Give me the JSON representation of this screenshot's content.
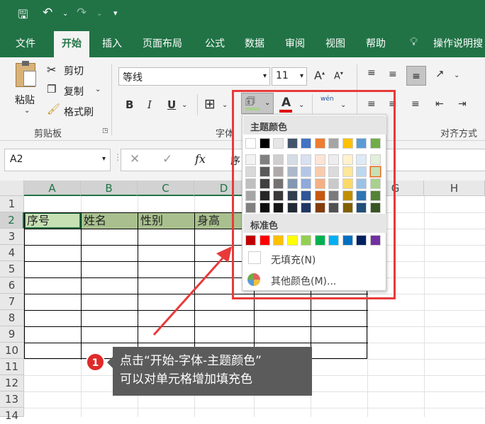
{
  "qat": {
    "save_icon": "save-icon",
    "undo_icon": "undo-icon",
    "redo_icon": "redo-icon",
    "customize_icon": "customize-icon"
  },
  "tabs": [
    "文件",
    "开始",
    "插入",
    "页面布局",
    "公式",
    "数据",
    "审阅",
    "视图",
    "帮助"
  ],
  "search": {
    "label": "操作说明搜",
    "icon": "lightbulb-icon"
  },
  "clipboard": {
    "paste": "粘贴",
    "cut": "剪切",
    "copy": "复制",
    "format_painter": "格式刷",
    "group": "剪贴板"
  },
  "font": {
    "name": "等线",
    "size": "11",
    "bold": "B",
    "italic": "I",
    "underline": "U",
    "font_color": "A",
    "phonetic": "wén",
    "group": "字体"
  },
  "alignment": {
    "group": "对齐方式"
  },
  "formula_bar": {
    "name_box": "A2",
    "value": "序"
  },
  "columns": [
    "A",
    "B",
    "C",
    "D",
    "E",
    "F",
    "G",
    "H"
  ],
  "rows": [
    "1",
    "2",
    "3",
    "4",
    "5",
    "6",
    "7",
    "8",
    "9",
    "10",
    "11",
    "12",
    "13",
    "14"
  ],
  "headers": [
    "序号",
    "姓名",
    "性别",
    "身高"
  ],
  "fill_menu": {
    "theme_title": "主题颜色",
    "standard_title": "标准色",
    "no_fill": "无填充(N)",
    "more_colors": "其他颜色(M)...",
    "theme_row": [
      "#ffffff",
      "#000000",
      "#e7e6e6",
      "#44546a",
      "#4472c4",
      "#ed7d31",
      "#a5a5a5",
      "#ffc000",
      "#5b9bd5",
      "#70ad47"
    ],
    "shades": [
      [
        "#f2f2f2",
        "#7f7f7f",
        "#d0cece",
        "#d6dce4",
        "#d9e1f2",
        "#fce4d6",
        "#ededed",
        "#fff2cc",
        "#ddebf7",
        "#e2efda"
      ],
      [
        "#d9d9d9",
        "#595959",
        "#aeaaaa",
        "#adb9ca",
        "#b4c6e7",
        "#f8cbad",
        "#dbdbdb",
        "#ffe699",
        "#bdd7ee",
        "#c6e0b4"
      ],
      [
        "#bfbfbf",
        "#404040",
        "#757171",
        "#8497b0",
        "#8ea9db",
        "#f4b084",
        "#c9c9c9",
        "#ffd966",
        "#9bc2e6",
        "#a9d08e"
      ],
      [
        "#a6a6a6",
        "#262626",
        "#3a3838",
        "#333f4f",
        "#2f5597",
        "#c65911",
        "#7b7b7b",
        "#bf8f00",
        "#2f75b5",
        "#548235"
      ],
      [
        "#808080",
        "#0d0d0d",
        "#161616",
        "#222b35",
        "#203764",
        "#833c0c",
        "#525252",
        "#806000",
        "#1f4e78",
        "#375623"
      ]
    ],
    "standard": [
      "#c00000",
      "#ff0000",
      "#ffc000",
      "#ffff00",
      "#92d050",
      "#00b050",
      "#00b0f0",
      "#0070c0",
      "#002060",
      "#7030a0"
    ]
  },
  "callout": {
    "number": "1",
    "line1": "点击“开始-字体-主题颜色”",
    "line2": "可以对单元格增加填充色"
  },
  "colors": {
    "excel_green": "#217346",
    "header_fill": "#c6e0b4",
    "highlight": "#e83a3a"
  }
}
